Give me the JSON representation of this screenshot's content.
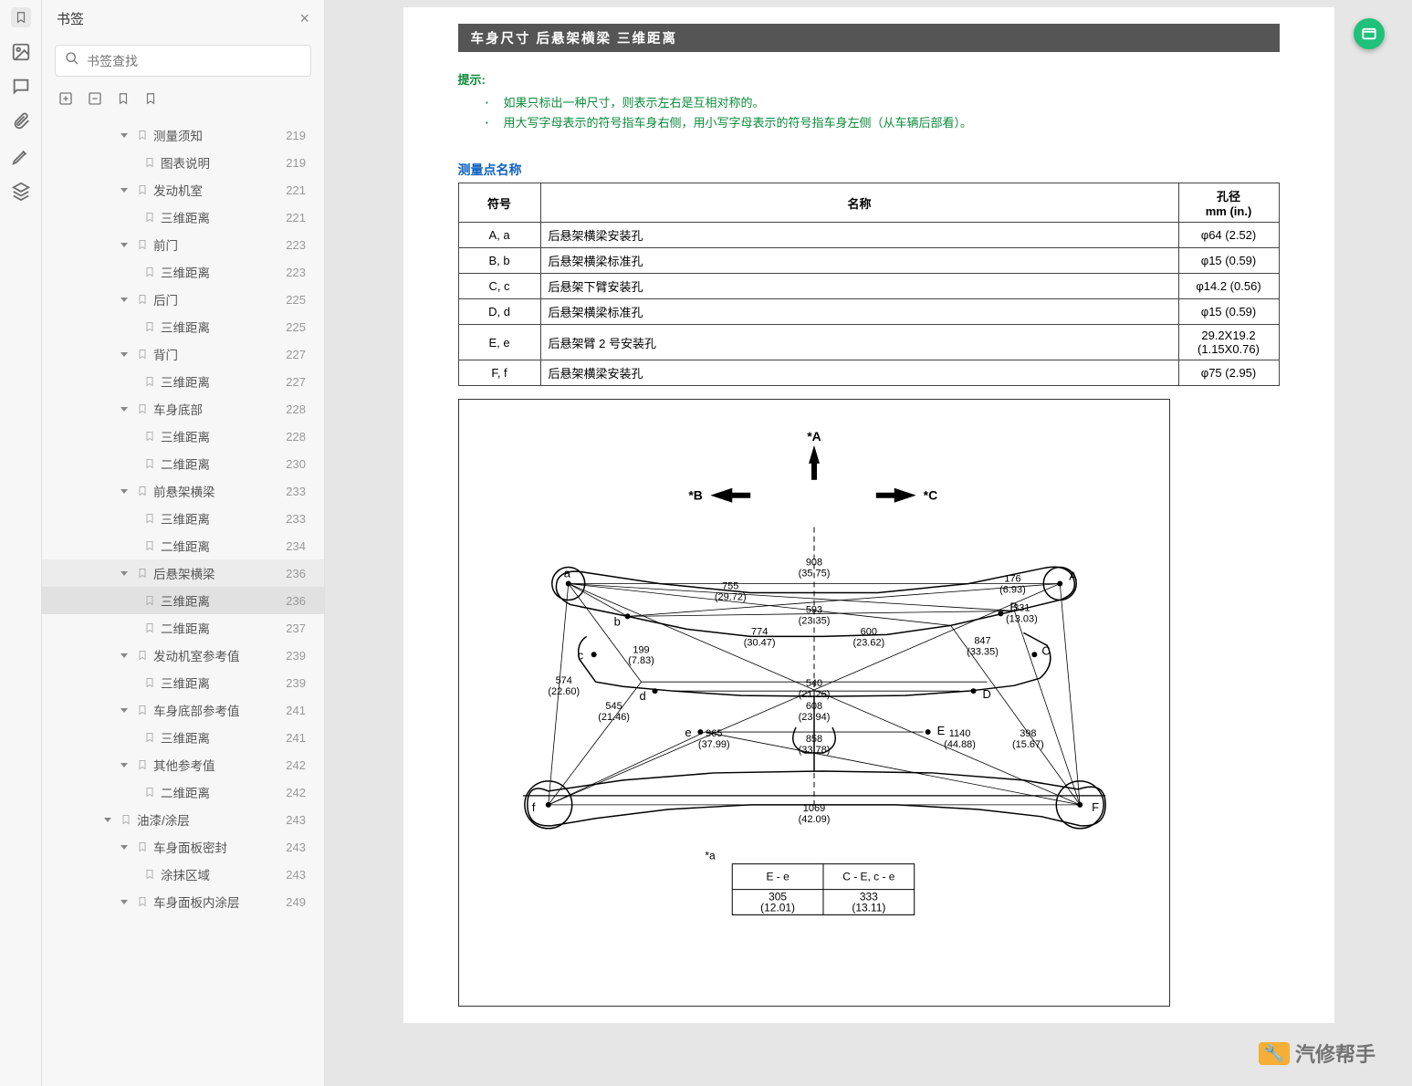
{
  "sidebar": {
    "title": "书签",
    "search_placeholder": "书签查找",
    "items": [
      {
        "label": "测量须知",
        "page": "219",
        "level": 2,
        "caret": true
      },
      {
        "label": "图表说明",
        "page": "219",
        "level": 3,
        "caret": false
      },
      {
        "label": "发动机室",
        "page": "221",
        "level": 2,
        "caret": true
      },
      {
        "label": "三维距离",
        "page": "221",
        "level": 3,
        "caret": false
      },
      {
        "label": "前门",
        "page": "223",
        "level": 2,
        "caret": true
      },
      {
        "label": "三维距离",
        "page": "223",
        "level": 3,
        "caret": false
      },
      {
        "label": "后门",
        "page": "225",
        "level": 2,
        "caret": true
      },
      {
        "label": "三维距离",
        "page": "225",
        "level": 3,
        "caret": false
      },
      {
        "label": "背门",
        "page": "227",
        "level": 2,
        "caret": true
      },
      {
        "label": "三维距离",
        "page": "227",
        "level": 3,
        "caret": false
      },
      {
        "label": "车身底部",
        "page": "228",
        "level": 2,
        "caret": true
      },
      {
        "label": "三维距离",
        "page": "228",
        "level": 3,
        "caret": false
      },
      {
        "label": "二维距离",
        "page": "230",
        "level": 3,
        "caret": false
      },
      {
        "label": "前悬架横梁",
        "page": "233",
        "level": 2,
        "caret": true
      },
      {
        "label": "三维距离",
        "page": "233",
        "level": 3,
        "caret": false
      },
      {
        "label": "二维距离",
        "page": "234",
        "level": 3,
        "caret": false
      },
      {
        "label": "后悬架横梁",
        "page": "236",
        "level": 2,
        "caret": true,
        "parent_active": true
      },
      {
        "label": "三维距离",
        "page": "236",
        "level": 3,
        "caret": false,
        "active": true
      },
      {
        "label": "二维距离",
        "page": "237",
        "level": 3,
        "caret": false
      },
      {
        "label": "发动机室参考值",
        "page": "239",
        "level": 2,
        "caret": true
      },
      {
        "label": "三维距离",
        "page": "239",
        "level": 3,
        "caret": false
      },
      {
        "label": "车身底部参考值",
        "page": "241",
        "level": 2,
        "caret": true
      },
      {
        "label": "三维距离",
        "page": "241",
        "level": 3,
        "caret": false
      },
      {
        "label": "其他参考值",
        "page": "242",
        "level": 2,
        "caret": true
      },
      {
        "label": "二维距离",
        "page": "242",
        "level": 3,
        "caret": false
      },
      {
        "label": "油漆/涂层",
        "page": "243",
        "level": 1,
        "caret": true
      },
      {
        "label": "车身面板密封",
        "page": "243",
        "level": 2,
        "caret": true
      },
      {
        "label": "涂抹区域",
        "page": "243",
        "level": 3,
        "caret": false
      },
      {
        "label": "车身面板内涂层",
        "page": "249",
        "level": 2,
        "caret": true
      }
    ]
  },
  "doc": {
    "title_bar": "车身尺寸  后悬架横梁  三维距离",
    "hint_title": "提示:",
    "hint1": "如果只标出一种尺寸，则表示左右是互相对称的。",
    "hint2": "用大写字母表示的符号指车身右侧，用小写字母表示的符号指车身左侧（从车辆后部看）。",
    "section_title": "测量点名称",
    "table": {
      "h_symbol": "符号",
      "h_name": "名称",
      "h_hole": "孔径",
      "h_hole_unit": "mm (in.)",
      "rows": [
        {
          "sym": "A, a",
          "name": "后悬架横梁安装孔",
          "hole": "φ64 (2.52)"
        },
        {
          "sym": "B, b",
          "name": "后悬架横梁标准孔",
          "hole": "φ15 (0.59)"
        },
        {
          "sym": "C, c",
          "name": "后悬架下臂安装孔",
          "hole": "φ14.2 (0.56)"
        },
        {
          "sym": "D, d",
          "name": "后悬架横梁标准孔",
          "hole": "φ15 (0.59)"
        },
        {
          "sym": "E, e",
          "name": "后悬架臂 2 号安装孔",
          "hole": "29.2X19.2 (1.15X0.76)"
        },
        {
          "sym": "F, f",
          "name": "后悬架横梁安装孔",
          "hole": "φ75 (2.95)"
        }
      ]
    },
    "diagram": {
      "labels": {
        "starA": "*A",
        "starB": "*B",
        "starC": "*C",
        "stara": "*a",
        "A": "A",
        "B": "B",
        "C": "C",
        "D": "D",
        "E": "E",
        "F": "F",
        "a": "a",
        "b": "b",
        "c": "c",
        "d": "d",
        "e": "e",
        "f": "f"
      },
      "dims": {
        "d908": "908",
        "d908i": "(35.75)",
        "d755": "755",
        "d755i": "(29.72)",
        "d176": "176",
        "d176i": "(6.93)",
        "d593": "593",
        "d593i": "(23.35)",
        "d331": "331",
        "d331i": "(13.03)",
        "d774": "774",
        "d774i": "(30.47)",
        "d600": "600",
        "d600i": "(23.62)",
        "d847": "847",
        "d847i": "(33.35)",
        "d199": "199",
        "d199i": "(7.83)",
        "d574": "574",
        "d574i": "(22.60)",
        "d540": "540",
        "d540i": "(21.26)",
        "d545": "545",
        "d545i": "(21.46)",
        "d608": "608",
        "d608i": "(23.94)",
        "d965": "965",
        "d965i": "(37.99)",
        "d858": "858",
        "d858i": "(33.78)",
        "d1140": "1140",
        "d1140i": "(44.88)",
        "d398": "398",
        "d398i": "(15.67)",
        "d1069": "1069",
        "d1069i": "(42.09)"
      },
      "subtable": {
        "h1": "E - e",
        "h2": "C - E, c - e",
        "v1": "305",
        "v1i": "(12.01)",
        "v2": "333",
        "v2i": "(13.11)"
      }
    },
    "watermark_text": "汽修帮手"
  }
}
